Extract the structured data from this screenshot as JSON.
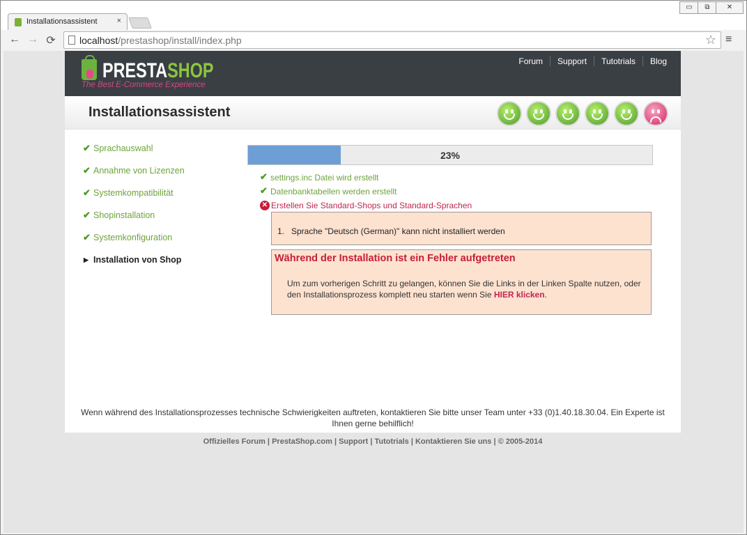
{
  "browser": {
    "tab_title": "Installationsassistent",
    "tab_close": "×",
    "url_host": "localhost",
    "url_path": "/prestashop/install/index.php",
    "window_controls": [
      "▭",
      "⧉",
      "✕"
    ]
  },
  "header": {
    "logo_part1": "PRESTA",
    "logo_part2": "SHOP",
    "tagline": "The Best E-Commerce Experience",
    "nav": [
      "Forum",
      "Support",
      "Tutotrials",
      "Blog"
    ]
  },
  "title": "Installationsassistent",
  "smileys": [
    "happy",
    "happy",
    "happy",
    "happy",
    "happy",
    "sad"
  ],
  "steps": [
    {
      "label": "Sprachauswahl",
      "done": true
    },
    {
      "label": "Annahme von Lizenzen",
      "done": true
    },
    {
      "label": "Systemkompatibilität",
      "done": true
    },
    {
      "label": "Shopinstallation",
      "done": true
    },
    {
      "label": "Systemkonfiguration",
      "done": true
    },
    {
      "label": "Installation von Shop",
      "done": false
    }
  ],
  "progress": {
    "percent": 23,
    "label": "23%"
  },
  "log": [
    {
      "text": "settings.inc Datei wird erstellt",
      "status": "ok"
    },
    {
      "text": "Datenbanktabellen werden erstellt",
      "status": "ok"
    },
    {
      "text": "Erstellen Sie Standard-Shops und Standard-Sprachen",
      "status": "error"
    }
  ],
  "error_list": [
    {
      "num": "1.",
      "text": "Sprache \"Deutsch (German)\" kann nicht installiert werden"
    }
  ],
  "error_box": {
    "title": "Während der Installation ist ein Fehler aufgetreten",
    "body_before": "Um zum vorherigen Schritt zu gelangen, können Sie die Links in der Linken Spalte nutzen, oder den Installationsprozess komplett neu starten wenn Sie ",
    "link": "HIER klicken",
    "body_after": "."
  },
  "footer_note": "Wenn während des Installationsprozesses technische Schwierigkeiten auftreten, kontaktieren Sie bitte unser Team unter +33 (0)1.40.18.30.04. Ein Experte ist Ihnen gerne behilflich!",
  "bottom_links": [
    "Offizielles Forum",
    "PrestaShop.com",
    "Support",
    "Tutotrials",
    "Kontaktieren Sie uns"
  ],
  "copyright": "© 2005-2014",
  "colors": {
    "progress_fill": "#6d9fd6",
    "success": "#6da33b",
    "error": "#c41e3a",
    "header_bg": "#3a3f44"
  }
}
